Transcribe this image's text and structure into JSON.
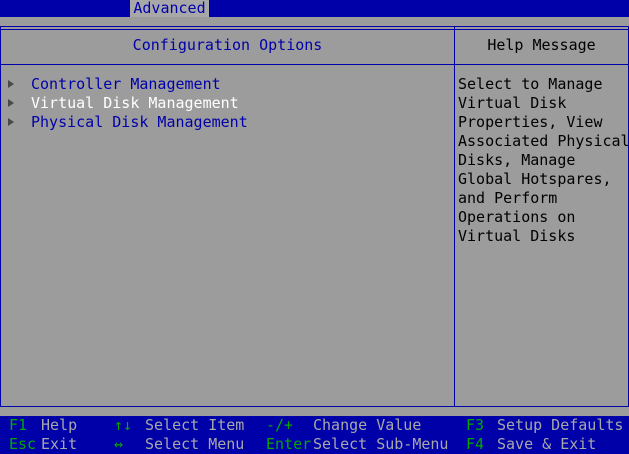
{
  "header": {
    "active_tab": "Advanced"
  },
  "panel": {
    "title": "Configuration Options",
    "items": [
      {
        "label": "Controller Management",
        "selected": false
      },
      {
        "label": "Virtual Disk Management",
        "selected": true
      },
      {
        "label": "Physical Disk Management",
        "selected": false
      }
    ]
  },
  "help": {
    "title": "Help Message",
    "lines": [
      "Select to Manage",
      "Virtual Disk",
      "Properties, View",
      "Associated Physical",
      "Disks, Manage",
      "Global Hotspares,",
      "and Perform",
      "Operations on",
      "Virtual Disks"
    ]
  },
  "footer": {
    "keys": [
      {
        "key": "F1",
        "desc": "Help"
      },
      {
        "key": "Esc",
        "desc": "Exit"
      },
      {
        "key": "↑↓",
        "desc": "Select Item"
      },
      {
        "key": "↔",
        "desc": "Select Menu"
      },
      {
        "key": "-/+",
        "desc": "Change Value"
      },
      {
        "key": "Enter",
        "desc": "Select Sub-Menu"
      },
      {
        "key": "F3",
        "desc": "Setup Defaults"
      },
      {
        "key": "F4",
        "desc": "Save & Exit"
      }
    ]
  },
  "colors": {
    "background": "#9c9c9c",
    "accent": "#0000a8",
    "selected_text": "#ffffff",
    "key_text": "#00a800",
    "footer_text": "#a8a8a8"
  }
}
